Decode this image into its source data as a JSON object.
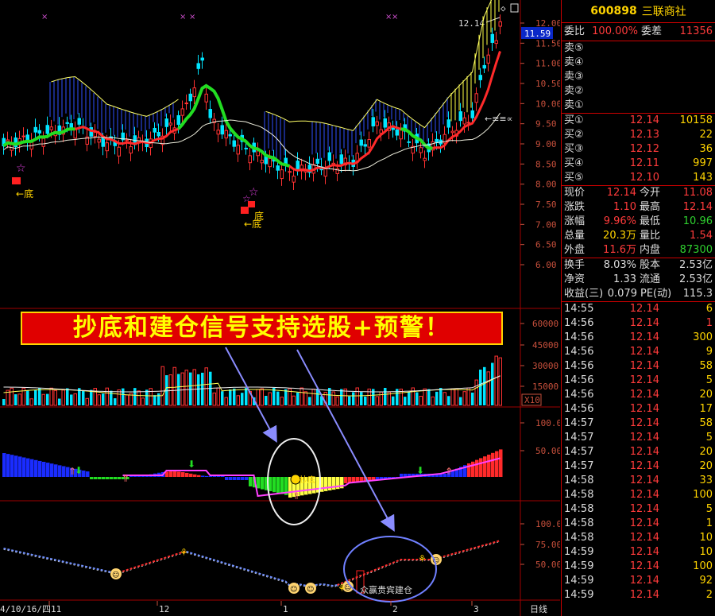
{
  "stock": {
    "code": "600898",
    "name": "三联商社"
  },
  "chart": {
    "current_price_tag": "11.59",
    "high_marker": "12.14",
    "price_ticks": [
      "12.00",
      "11.50",
      "11.00",
      "10.50",
      "10.00",
      "9.50",
      "9.00",
      "8.50",
      "8.00",
      "7.50",
      "7.00",
      "6.50",
      "6.00"
    ],
    "vol_ticks": [
      "60000",
      "45000",
      "30000",
      "15000"
    ],
    "vol_unit": "X10",
    "ind1_ticks": [
      "100.0",
      "50.00"
    ],
    "ind2_ticks": [
      "100.0",
      "75.00",
      "50.00"
    ],
    "bottom_label": "底",
    "signal_label": "众赢贵宾建仓",
    "date_labels": {
      "first": "4/10/16/四",
      "m11": "11",
      "m12": "12",
      "m1": "1",
      "m2": "2",
      "m3": "3"
    },
    "period": "日线",
    "banner": "抄底和建仓信号支持选股+预警！",
    "colors": {
      "up": "#ff3232",
      "down": "#00e5ff",
      "ma_green": "#22dd22",
      "ma_red": "#ff2a2a",
      "ma_white": "#eeeedd",
      "fill_blue": "#3050ff",
      "fill_yellow": "#ffff44",
      "panel_line": "#a00000"
    }
  },
  "quote": {
    "weibi_label": "委比",
    "weibi": "100.00%",
    "weicha_label": "委差",
    "weicha": "11356",
    "sells": [
      {
        "label": "卖⑤"
      },
      {
        "label": "卖④"
      },
      {
        "label": "卖③"
      },
      {
        "label": "卖②"
      },
      {
        "label": "卖①"
      }
    ],
    "buys": [
      {
        "label": "买①",
        "price": "12.14",
        "vol": "10158"
      },
      {
        "label": "买②",
        "price": "12.13",
        "vol": "22"
      },
      {
        "label": "买③",
        "price": "12.12",
        "vol": "36"
      },
      {
        "label": "买④",
        "price": "12.11",
        "vol": "997"
      },
      {
        "label": "买⑤",
        "price": "12.10",
        "vol": "143"
      }
    ],
    "stats": [
      {
        "l1": "现价",
        "v1": "12.14",
        "c1": "red",
        "l2": "今开",
        "v2": "11.08",
        "c2": "red"
      },
      {
        "l1": "涨跌",
        "v1": "1.10",
        "c1": "red",
        "l2": "最高",
        "v2": "12.14",
        "c2": "red"
      },
      {
        "l1": "涨幅",
        "v1": "9.96%",
        "c1": "red",
        "l2": "最低",
        "v2": "10.96",
        "c2": "green"
      },
      {
        "l1": "总量",
        "v1": "20.3万",
        "c1": "yel",
        "l2": "量比",
        "v2": "1.54",
        "c2": "red"
      },
      {
        "l1": "外盘",
        "v1": "11.6万",
        "c1": "red",
        "l2": "内盘",
        "v2": "87300",
        "c2": "green"
      }
    ],
    "fin": [
      {
        "l1": "换手",
        "v1": "8.03%",
        "l2": "股本",
        "v2": "2.53亿"
      },
      {
        "l1": "净资",
        "v1": "1.33",
        "l2": "流通",
        "v2": "2.53亿"
      },
      {
        "l1": "收益(三)",
        "v1": "0.079",
        "l2": "PE(动)",
        "v2": "115.3"
      }
    ],
    "ticks": [
      {
        "t": "14:55",
        "p": "12.14",
        "v": "6",
        "c": "yel"
      },
      {
        "t": "14:56",
        "p": "12.14",
        "v": "1",
        "c": "red"
      },
      {
        "t": "14:56",
        "p": "12.14",
        "v": "300",
        "c": "yel"
      },
      {
        "t": "14:56",
        "p": "12.14",
        "v": "9",
        "c": "yel"
      },
      {
        "t": "14:56",
        "p": "12.14",
        "v": "58",
        "c": "yel"
      },
      {
        "t": "14:56",
        "p": "12.14",
        "v": "5",
        "c": "yel"
      },
      {
        "t": "14:56",
        "p": "12.14",
        "v": "20",
        "c": "yel"
      },
      {
        "t": "14:56",
        "p": "12.14",
        "v": "17",
        "c": "yel"
      },
      {
        "t": "14:57",
        "p": "12.14",
        "v": "58",
        "c": "yel"
      },
      {
        "t": "14:57",
        "p": "12.14",
        "v": "5",
        "c": "yel"
      },
      {
        "t": "14:57",
        "p": "12.14",
        "v": "20",
        "c": "yel"
      },
      {
        "t": "14:57",
        "p": "12.14",
        "v": "20",
        "c": "yel"
      },
      {
        "t": "14:58",
        "p": "12.14",
        "v": "33",
        "c": "yel"
      },
      {
        "t": "14:58",
        "p": "12.14",
        "v": "100",
        "c": "yel"
      },
      {
        "t": "14:58",
        "p": "12.14",
        "v": "5",
        "c": "yel"
      },
      {
        "t": "14:58",
        "p": "12.14",
        "v": "1",
        "c": "yel"
      },
      {
        "t": "14:58",
        "p": "12.14",
        "v": "10",
        "c": "yel"
      },
      {
        "t": "14:59",
        "p": "12.14",
        "v": "10",
        "c": "yel"
      },
      {
        "t": "14:59",
        "p": "12.14",
        "v": "100",
        "c": "yel"
      },
      {
        "t": "14:59",
        "p": "12.14",
        "v": "92",
        "c": "yel"
      },
      {
        "t": "14:59",
        "p": "12.14",
        "v": "2",
        "c": "yel"
      }
    ]
  }
}
